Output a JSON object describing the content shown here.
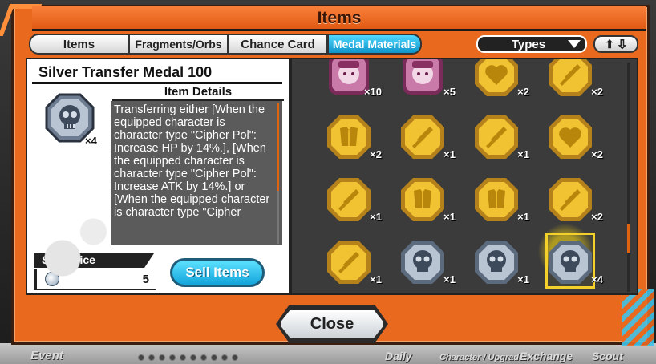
{
  "window": {
    "title": "Items"
  },
  "tabs": [
    {
      "label": "Items",
      "active": false
    },
    {
      "label": "Fragments/Orbs",
      "active": false
    },
    {
      "label": "Chance Card",
      "active": false
    },
    {
      "label": "Medal Materials",
      "active": true
    }
  ],
  "filter": {
    "selected": "Types"
  },
  "colors": {
    "frame": "#e9691f",
    "accent_blue": "#13a4db",
    "gold": "#e9b62a",
    "silver": "#a8b4c4"
  },
  "detail": {
    "item_name": "Silver Transfer Medal 100",
    "quantity": "×4",
    "details_header": "Item Details",
    "details_text": "Transferring either [When the equipped character is character type \"Cipher Pol\": Increase HP by 14%.], [When the equipped character is character type \"Cipher Pol\": Increase ATK by 14%.] or [When the equipped character is character type \"Cipher",
    "sale_price_label": "Sale Price",
    "sale_price_value": "5",
    "sell_button": "Sell Items"
  },
  "grid": [
    {
      "kind": "pink-portrait",
      "icon": "character-portrait-icon",
      "count": "×10"
    },
    {
      "kind": "pink-portrait",
      "icon": "character-portrait-icon",
      "count": "×5"
    },
    {
      "kind": "gold",
      "icon": "heart-icon",
      "count": "×2"
    },
    {
      "kind": "gold",
      "icon": "sword-icon",
      "count": "×2"
    },
    {
      "kind": "gold",
      "icon": "armor-icon",
      "count": "×2"
    },
    {
      "kind": "gold",
      "icon": "sword-icon",
      "count": "×1"
    },
    {
      "kind": "gold",
      "icon": "sword-icon",
      "count": "×1"
    },
    {
      "kind": "gold",
      "icon": "heart-icon",
      "count": "×2"
    },
    {
      "kind": "gold",
      "icon": "sword-icon",
      "count": "×1"
    },
    {
      "kind": "gold",
      "icon": "armor-icon",
      "count": "×1"
    },
    {
      "kind": "gold",
      "icon": "armor-icon",
      "count": "×1"
    },
    {
      "kind": "gold",
      "icon": "sword-icon",
      "count": "×2"
    },
    {
      "kind": "gold",
      "icon": "sword-icon",
      "count": "×1"
    },
    {
      "kind": "silver",
      "icon": "skull-icon",
      "count": "×1"
    },
    {
      "kind": "silver",
      "icon": "skull-icon",
      "count": "×1"
    },
    {
      "kind": "silver",
      "icon": "skull-icon",
      "count": "×4",
      "selected": true
    }
  ],
  "footer": {
    "close_button": "Close"
  },
  "background_nav": [
    {
      "label": "Event"
    },
    {
      "label": "Daily"
    },
    {
      "label": "Character / Upgrade"
    },
    {
      "label": "Exchange"
    },
    {
      "label": "Scout"
    }
  ]
}
